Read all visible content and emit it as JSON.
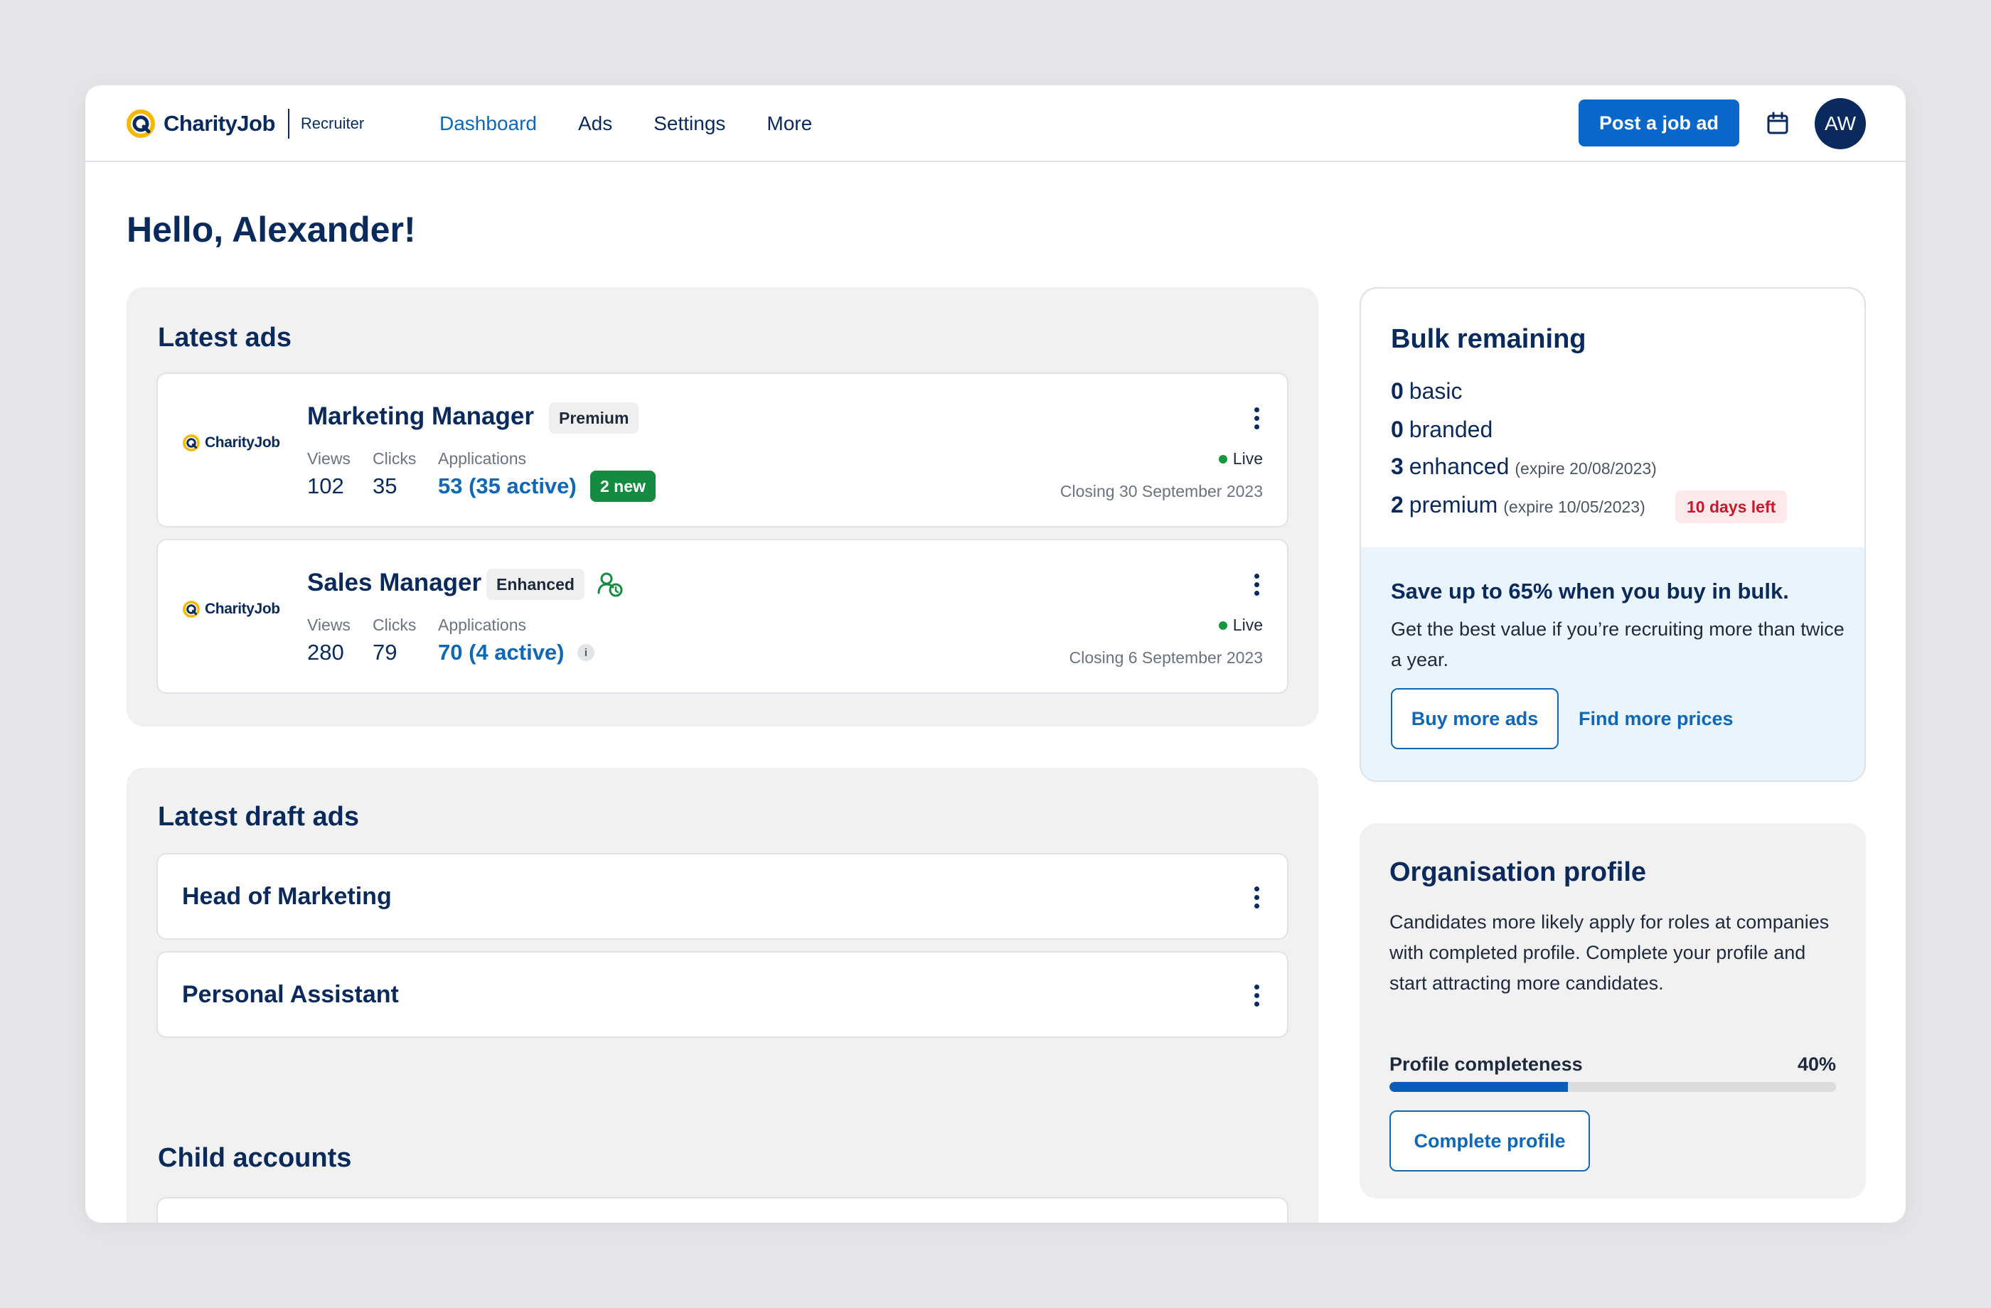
{
  "brand": {
    "name": "CharityJob",
    "sub": "Recruiter"
  },
  "nav": {
    "links": [
      "Dashboard",
      "Ads",
      "Settings",
      "More"
    ],
    "active": "Dashboard",
    "post_label": "Post a job ad",
    "avatar_initials": "AW"
  },
  "greeting": "Hello, Alexander!",
  "latest_ads": {
    "title": "Latest ads",
    "stat_labels": {
      "views": "Views",
      "clicks": "Clicks",
      "applications": "Applications"
    },
    "items": [
      {
        "title": "Marketing Manager",
        "tag": "Premium",
        "org": "CharityJob",
        "views": "102",
        "clicks": "35",
        "applications": "53 (35 active)",
        "new_badge": "2 new",
        "status": "Live",
        "closing": "Closing 30 September 2023"
      },
      {
        "title": "Sales Manager",
        "tag": "Enhanced",
        "org": "CharityJob",
        "views": "280",
        "clicks": "79",
        "applications": "70 (4 active)",
        "status": "Live",
        "closing": "Closing 6 September 2023"
      }
    ]
  },
  "latest_drafts": {
    "title": "Latest draft ads",
    "items": [
      "Head of Marketing",
      "Personal Assistant"
    ]
  },
  "child_accounts": {
    "title": "Child accounts"
  },
  "bulk": {
    "title": "Bulk remaining",
    "rows": [
      {
        "count": "0",
        "type": "basic",
        "expire": ""
      },
      {
        "count": "0",
        "type": "branded",
        "expire": ""
      },
      {
        "count": "3",
        "type": "enhanced",
        "expire": "(expire 20/08/2023)"
      },
      {
        "count": "2",
        "type": "premium",
        "expire": "(expire 10/05/2023)"
      }
    ],
    "days_left": "10 days left",
    "save_title": "Save up to 65% when you buy in bulk.",
    "save_text": "Get the best value if you’re recruiting more than twice a year.",
    "buy_label": "Buy more ads",
    "prices_label": "Find more prices"
  },
  "org_profile": {
    "title": "Organisation profile",
    "text": "Candidates more likely apply for roles at companies with completed profile. Complete your profile and start attracting more candidates.",
    "completeness_label": "Profile completeness",
    "completeness_value": "40%",
    "completeness_fraction": 0.4,
    "button_label": "Complete profile"
  },
  "colors": {
    "navy": "#0b2a5c",
    "primary": "#0967c9",
    "link": "#0f67b6",
    "success": "#158b42",
    "danger": "#c9182b",
    "logo_yellow": "#f5b800"
  }
}
